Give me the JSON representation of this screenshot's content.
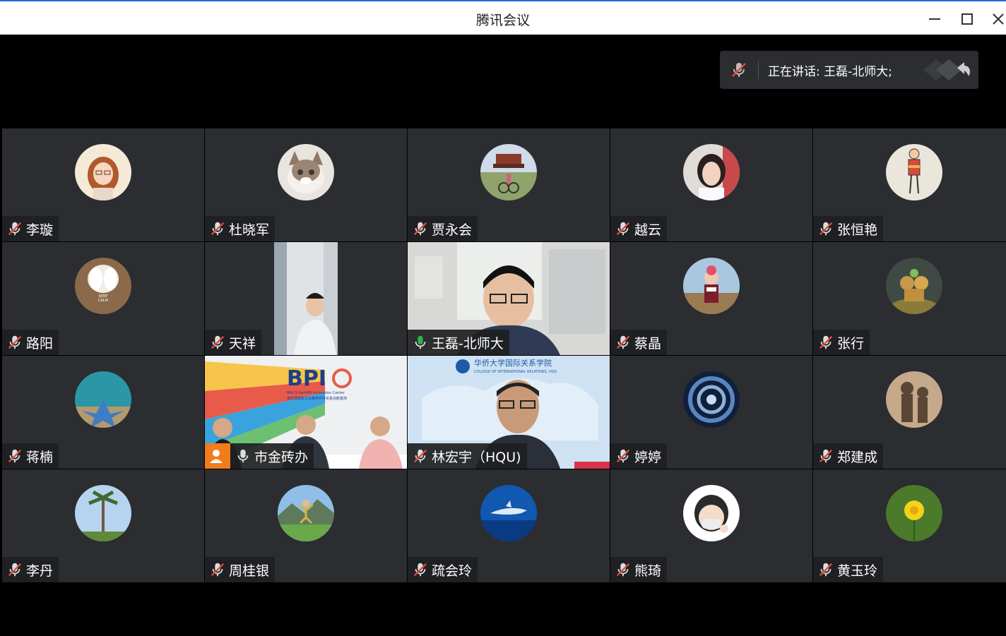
{
  "window": {
    "title": "腾讯会议",
    "controls": [
      "minimize-icon",
      "maximize-icon",
      "close-icon"
    ]
  },
  "speaker": {
    "label": "正在讲话: 王磊-北师大;",
    "icons": [
      "mic-muted-icon",
      "arrow-back-icon"
    ]
  },
  "colors": {
    "muted_red": "#e04a3f",
    "active_green": "#31b34a",
    "tile_bg": "#2b2d31",
    "orange": "#f07c1b"
  },
  "participants": [
    {
      "name": "李璇",
      "muted": true,
      "avatar": "cartoon-girl"
    },
    {
      "name": "杜晓军",
      "muted": true,
      "avatar": "cat"
    },
    {
      "name": "贾永会",
      "muted": true,
      "avatar": "bicycle"
    },
    {
      "name": "越云",
      "muted": true,
      "avatar": "woman-portrait"
    },
    {
      "name": "张恒艳",
      "muted": true,
      "avatar": "drawing"
    },
    {
      "name": "路阳",
      "muted": true,
      "avatar": "garlic"
    },
    {
      "name": "天祥",
      "muted": true,
      "video": true
    },
    {
      "name": "王磊-北师大",
      "muted": false,
      "speaking": true,
      "video": true
    },
    {
      "name": "蔡晶",
      "muted": true,
      "avatar": "child"
    },
    {
      "name": "张行",
      "muted": true,
      "avatar": "monkey-toys"
    },
    {
      "name": "蒋楠",
      "muted": true,
      "avatar": "starfish"
    },
    {
      "name": "市金砖办",
      "muted": false,
      "video": true,
      "host": true
    },
    {
      "name": "林宏宇（HQU)",
      "muted": true,
      "video": true
    },
    {
      "name": "婷婷",
      "muted": true,
      "avatar": "spiral"
    },
    {
      "name": "郑建成",
      "muted": true,
      "avatar": "shadows"
    },
    {
      "name": "李丹",
      "muted": true,
      "avatar": "palm-tree"
    },
    {
      "name": "周桂银",
      "muted": true,
      "avatar": "mountain-jump"
    },
    {
      "name": "疏会玲",
      "muted": true,
      "avatar": "dolphin"
    },
    {
      "name": "熊琦",
      "muted": true,
      "avatar": "cartoon-face"
    },
    {
      "name": "黄玉玲",
      "muted": true,
      "avatar": "yellow-flower"
    }
  ],
  "bpi_banner": {
    "logo": "BPI",
    "subtitle": "BRICS PartNIR Innovation Center",
    "subtitle_cn": "金砖国家新工业革命伙伴关系创新基地"
  },
  "hqu_banner": {
    "title_cn": "华侨大学国际关系学院",
    "title_en": "COLLEGE OF INTERNATIONAL RELATIONS, HQU"
  }
}
